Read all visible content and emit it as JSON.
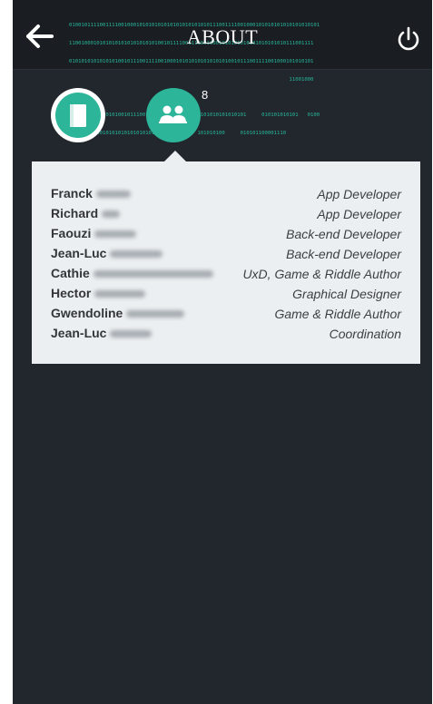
{
  "header": {
    "title": "ABOUT",
    "back_icon": "arrow-left-icon",
    "power_icon": "power-icon",
    "binary_lines": [
      "0100101111001111001000101010101010101010101010111001111001000101010101010101010101",
      "11001000101010101010101010101001011110011110010001010101010101010101010111001111",
      "01010101010101010010111001111001000101010101010101010010111001111001000101010101",
      "                                                                        11001000",
      "",
      "0101010101010101001011100111100100010101010101010101010101     010101010101   0100",
      "  11100100010101010101010101010101001010  101010100     010101100001110"
    ]
  },
  "tabs": {
    "book_icon": "book-icon",
    "team_icon": "team-icon",
    "team_count": "8"
  },
  "credits": [
    {
      "first": "Franck",
      "role": "App Developer"
    },
    {
      "first": "Richard",
      "role": "App Developer"
    },
    {
      "first": "Faouzi",
      "role": "Back-end Developer"
    },
    {
      "first": "Jean-Luc",
      "role": "Back-end Developer"
    },
    {
      "first": "Cathie",
      "role": "UxD, Game & Riddle Author"
    },
    {
      "first": "Hector",
      "role": "Graphical Designer"
    },
    {
      "first": "Gwendoline",
      "role": "Game & Riddle Author"
    },
    {
      "first": "Jean-Luc",
      "role": "Coordination"
    }
  ],
  "colors": {
    "background": "#22262d",
    "header": "#1a1d22",
    "accent": "#2cb599",
    "card": "#eceff1"
  }
}
